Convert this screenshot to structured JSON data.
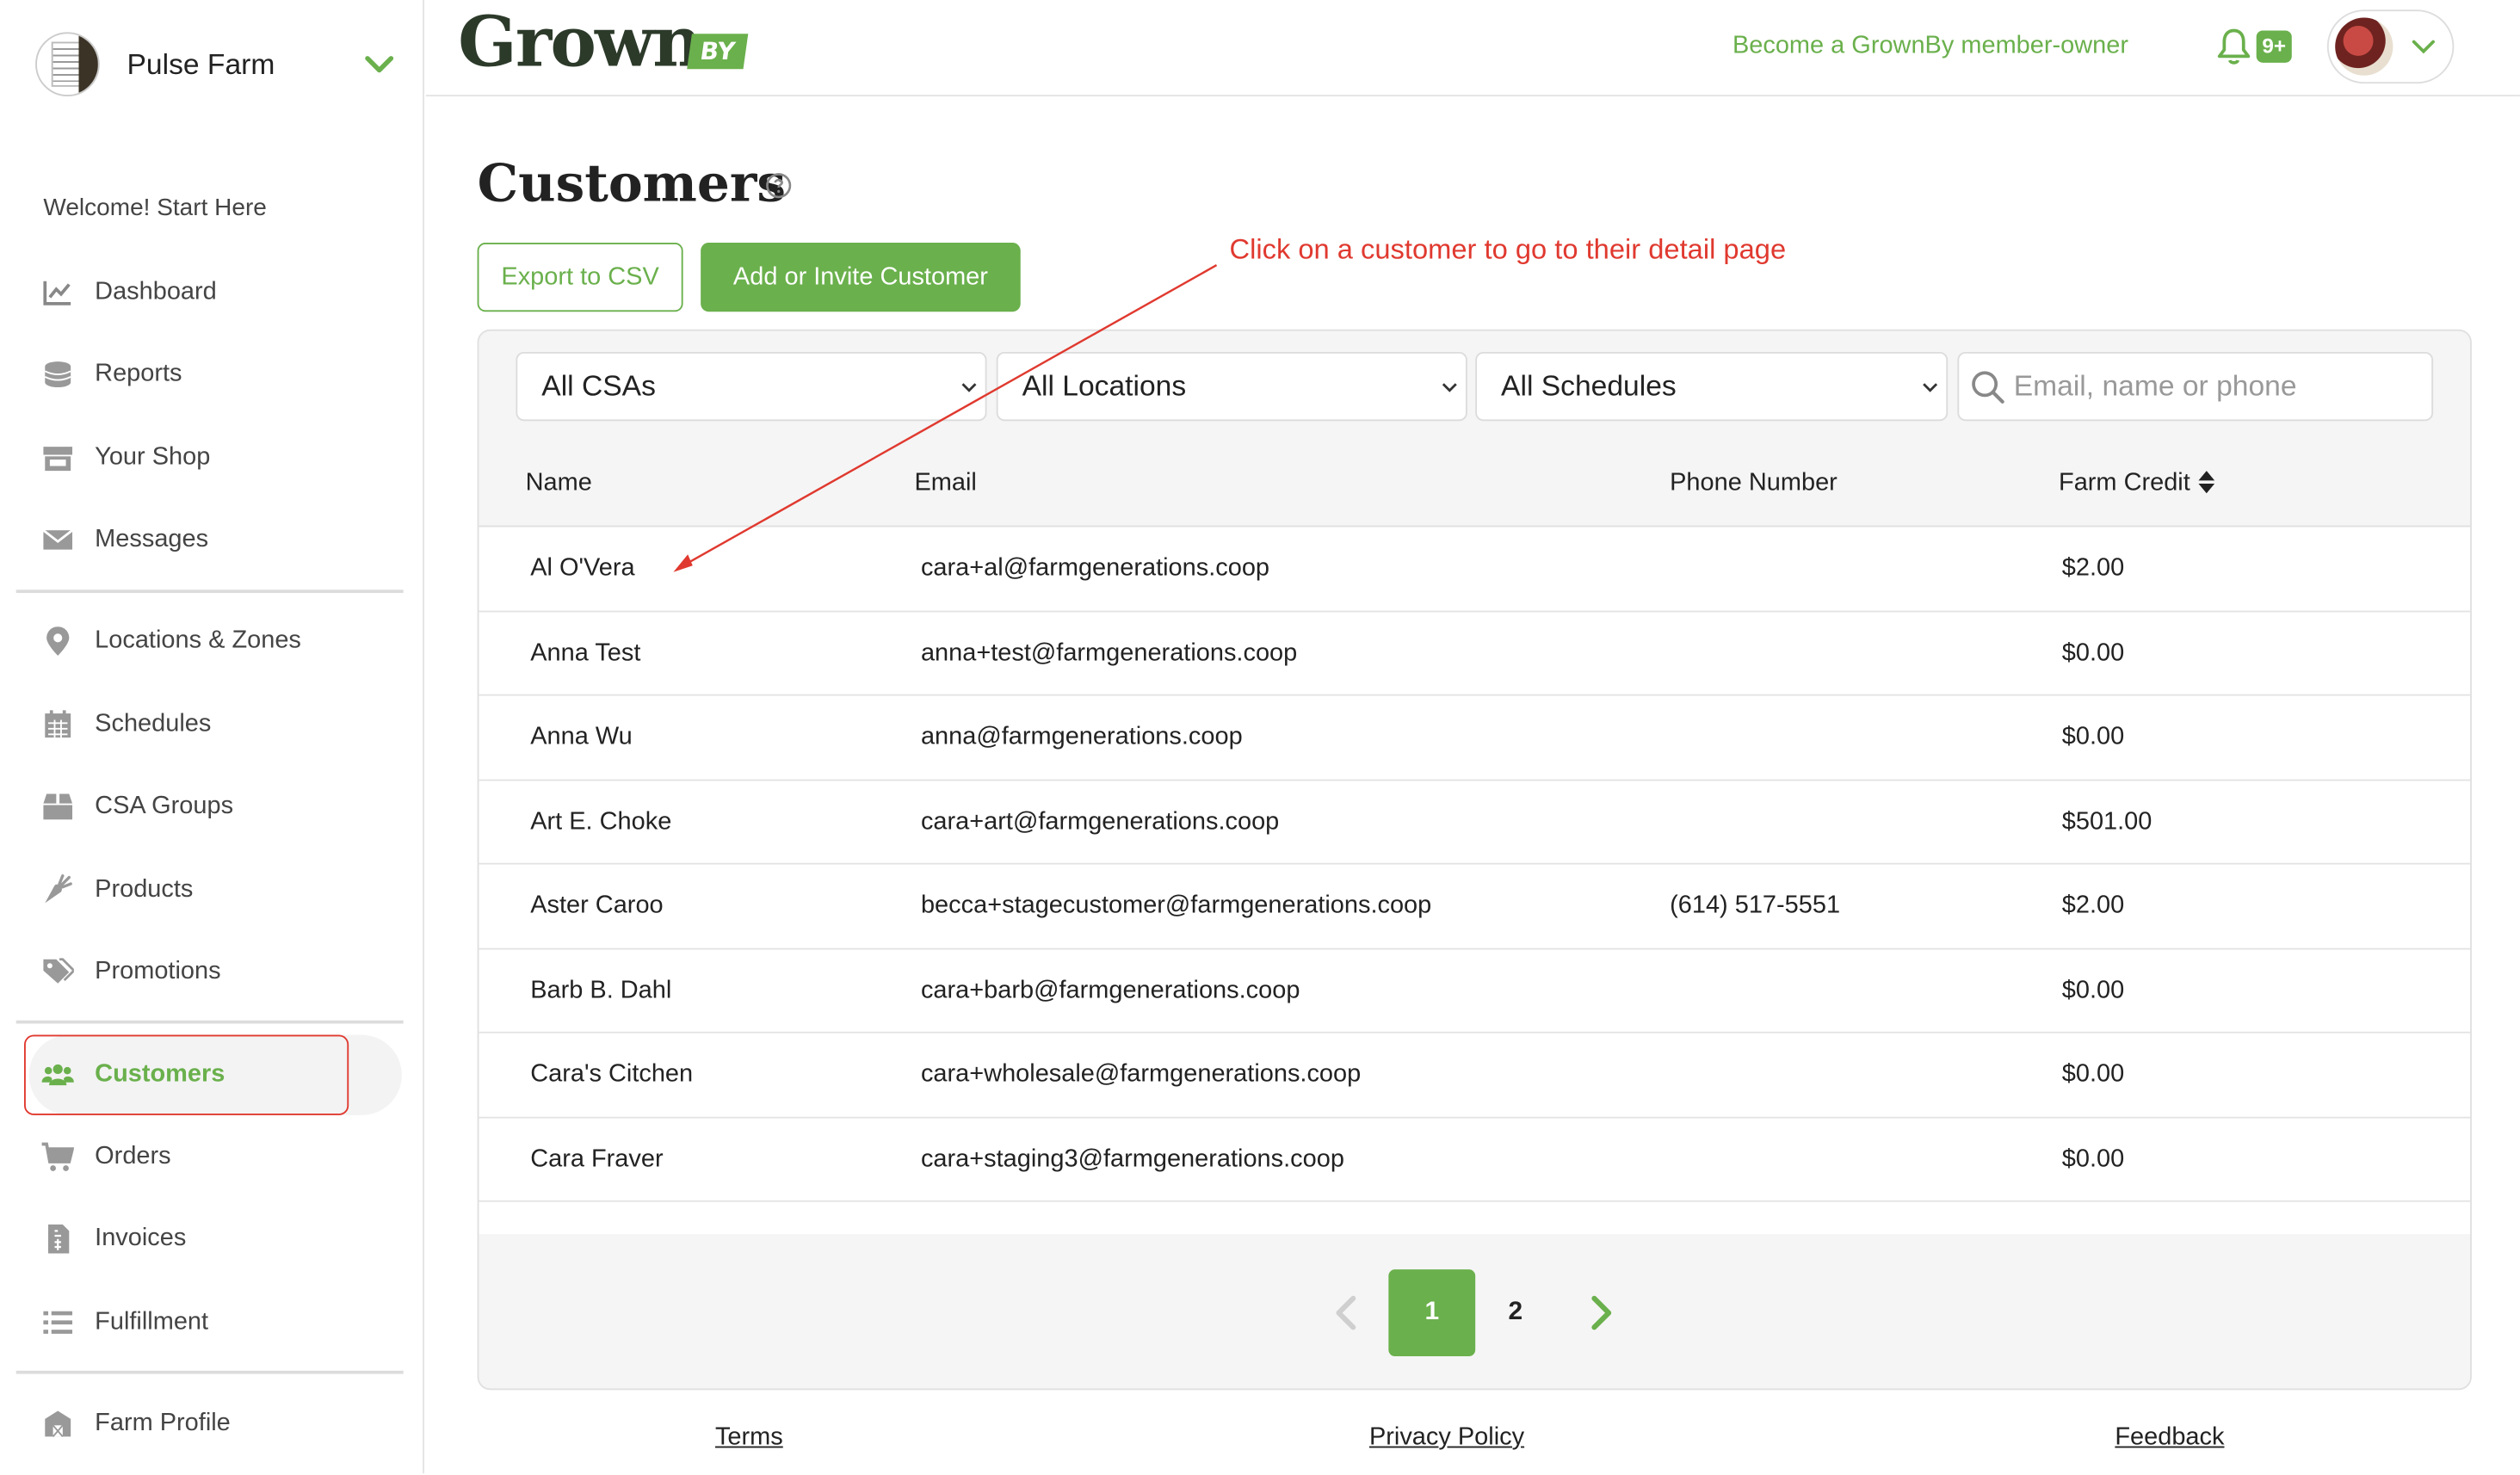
{
  "sidebar": {
    "farm_name": "Pulse Farm",
    "welcome": "Welcome! Start Here",
    "items": [
      {
        "label": "Dashboard",
        "icon": "chart-line-icon"
      },
      {
        "label": "Reports",
        "icon": "coins-icon"
      },
      {
        "label": "Your Shop",
        "icon": "store-icon"
      },
      {
        "label": "Messages",
        "icon": "envelope-icon"
      },
      {
        "label": "Locations & Zones",
        "icon": "map-pin-icon"
      },
      {
        "label": "Schedules",
        "icon": "calendar-icon"
      },
      {
        "label": "CSA Groups",
        "icon": "box-icon"
      },
      {
        "label": "Products",
        "icon": "carrot-icon"
      },
      {
        "label": "Promotions",
        "icon": "tags-icon"
      },
      {
        "label": "Customers",
        "icon": "users-icon",
        "active": true
      },
      {
        "label": "Orders",
        "icon": "cart-icon"
      },
      {
        "label": "Invoices",
        "icon": "invoice-icon"
      },
      {
        "label": "Fulfillment",
        "icon": "list-icon"
      },
      {
        "label": "Farm Profile",
        "icon": "barn-icon"
      }
    ]
  },
  "header": {
    "brand": "Grown",
    "brand_suffix": "BY",
    "member_link": "Become a GrownBy member-owner",
    "notification_count": "9+"
  },
  "main": {
    "title": "Customers",
    "export_label": "Export to CSV",
    "add_label": "Add or Invite Customer",
    "annotation": "Click on a customer to go to their detail page",
    "filters": {
      "csa": "All CSAs",
      "location": "All Locations",
      "schedule": "All Schedules",
      "search_placeholder": "Email, name or phone"
    },
    "columns": [
      "Name",
      "Email",
      "Phone Number",
      "Farm Credit"
    ],
    "rows": [
      {
        "name": "Al O'Vera",
        "email": "cara+al@farmgenerations.coop",
        "phone": "",
        "credit": "$2.00"
      },
      {
        "name": "Anna Test",
        "email": "anna+test@farmgenerations.coop",
        "phone": "",
        "credit": "$0.00"
      },
      {
        "name": "Anna Wu",
        "email": "anna@farmgenerations.coop",
        "phone": "",
        "credit": "$0.00"
      },
      {
        "name": "Art E. Choke",
        "email": "cara+art@farmgenerations.coop",
        "phone": "",
        "credit": "$501.00"
      },
      {
        "name": "Aster Caroo",
        "email": "becca+stagecustomer@farmgenerations.coop",
        "phone": "(614) 517-5551",
        "credit": "$2.00"
      },
      {
        "name": "Barb B. Dahl",
        "email": "cara+barb@farmgenerations.coop",
        "phone": "",
        "credit": "$0.00"
      },
      {
        "name": "Cara's Citchen",
        "email": "cara+wholesale@farmgenerations.coop",
        "phone": "",
        "credit": "$0.00"
      },
      {
        "name": "Cara Fraver",
        "email": "cara+staging3@farmgenerations.coop",
        "phone": "",
        "credit": "$0.00"
      }
    ],
    "pagination": {
      "current": "1",
      "next": "2"
    }
  },
  "footer": {
    "terms": "Terms",
    "privacy": "Privacy Policy",
    "feedback": "Feedback"
  },
  "colors": {
    "accent": "#6ab04c",
    "annotation": "#e0392f"
  }
}
